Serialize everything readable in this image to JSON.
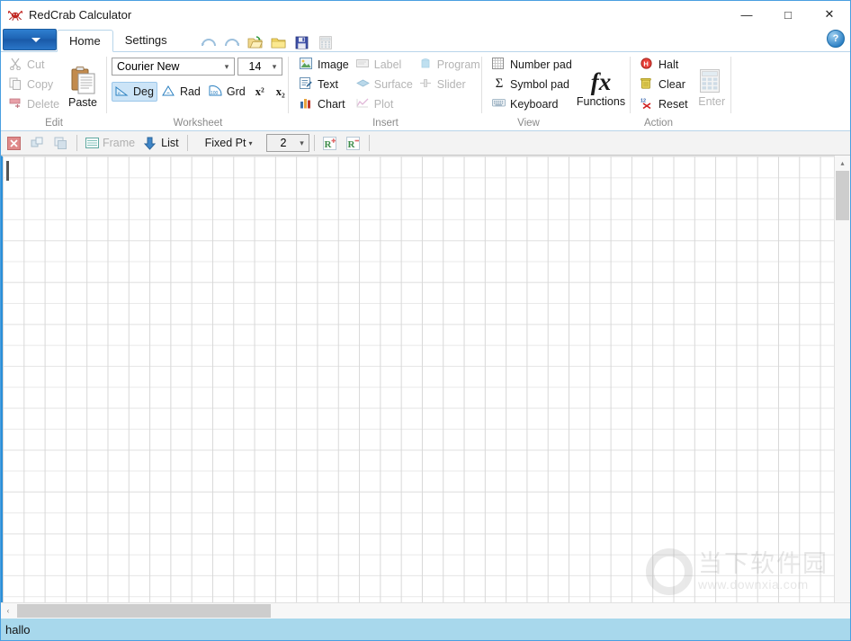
{
  "window": {
    "title": "RedCrab Calculator",
    "icon": "redcrab-icon",
    "minimize": "—",
    "maximize": "□",
    "close": "✕"
  },
  "tabs": {
    "app_button": "file-menu-chevron",
    "items": [
      {
        "label": "Home",
        "active": true
      },
      {
        "label": "Settings",
        "active": false
      }
    ],
    "help_label": "?",
    "quick_access": [
      {
        "name": "undo-icon",
        "label": "Undo",
        "disabled": true
      },
      {
        "name": "redo-icon",
        "label": "Redo",
        "disabled": true
      },
      {
        "name": "open-icon",
        "label": "Open",
        "disabled": false
      },
      {
        "name": "folder-icon",
        "label": "Folder",
        "disabled": false
      },
      {
        "name": "save-icon",
        "label": "Save",
        "disabled": false
      },
      {
        "name": "calculator-icon",
        "label": "Calculator",
        "disabled": true
      }
    ]
  },
  "ribbon": {
    "groups": [
      {
        "name": "edit",
        "label": "Edit",
        "items": [
          {
            "label": "Cut",
            "icon": "cut-icon",
            "disabled": true
          },
          {
            "label": "Copy",
            "icon": "copy-icon",
            "disabled": true
          },
          {
            "label": "Delete",
            "icon": "delete-icon",
            "disabled": true
          },
          {
            "label": "Paste",
            "icon": "paste-icon",
            "disabled": false
          }
        ]
      },
      {
        "name": "worksheet",
        "label": "Worksheet",
        "font_name": "Courier New",
        "font_size": "14",
        "items": [
          {
            "label": "Deg",
            "icon": "angle-deg-icon",
            "selected": true
          },
          {
            "label": "Rad",
            "icon": "angle-rad-icon",
            "selected": false
          },
          {
            "label": "Grd",
            "icon": "angle-grd-icon",
            "selected": false
          },
          {
            "label": "x²",
            "icon": "superscript-icon",
            "selected": false
          },
          {
            "label": "x₂",
            "icon": "subscript-icon",
            "selected": false
          }
        ]
      },
      {
        "name": "insert",
        "label": "Insert",
        "items": [
          {
            "label": "Image",
            "icon": "image-icon",
            "disabled": false
          },
          {
            "label": "Label",
            "icon": "label-icon",
            "disabled": true
          },
          {
            "label": "Program",
            "icon": "program-icon",
            "disabled": true
          },
          {
            "label": "Text",
            "icon": "text-icon",
            "disabled": false
          },
          {
            "label": "Surface",
            "icon": "surface-icon",
            "disabled": true
          },
          {
            "label": "Slider",
            "icon": "slider-icon",
            "disabled": true
          },
          {
            "label": "Chart",
            "icon": "chart-icon",
            "disabled": false
          },
          {
            "label": "Plot",
            "icon": "plot-icon",
            "disabled": true
          }
        ]
      },
      {
        "name": "view",
        "label": "View",
        "items": [
          {
            "label": "Number pad",
            "icon": "number-pad-icon",
            "disabled": false
          },
          {
            "label": "Symbol pad",
            "icon": "sigma-icon",
            "disabled": false
          },
          {
            "label": "Keyboard",
            "icon": "keyboard-icon",
            "disabled": false
          },
          {
            "label": "Functions",
            "icon": "fx-icon",
            "disabled": false
          }
        ]
      },
      {
        "name": "action",
        "label": "Action",
        "items": [
          {
            "label": "Halt",
            "icon": "halt-icon",
            "disabled": false
          },
          {
            "label": "Clear",
            "icon": "trash-icon",
            "disabled": false
          },
          {
            "label": "Reset",
            "icon": "reset-icon",
            "disabled": false
          },
          {
            "label": "Enter",
            "icon": "enter-icon",
            "disabled": true
          }
        ]
      }
    ]
  },
  "toolbar2": {
    "close_label": "✕",
    "frame_label": "Frame",
    "list_label": "List",
    "format_label": "Fixed Pt",
    "decimals_value": "2",
    "icons": [
      {
        "name": "delete-red-icon",
        "disabled": false
      },
      {
        "name": "group-icon",
        "disabled": true
      },
      {
        "name": "arrange-icon",
        "disabled": true
      },
      {
        "name": "frame-icon",
        "disabled": true
      },
      {
        "name": "list-down-icon",
        "disabled": false
      },
      {
        "name": "increase-decimals-icon",
        "disabled": false
      },
      {
        "name": "decrease-decimals-icon",
        "disabled": false
      }
    ]
  },
  "worksheet": {
    "content": "",
    "cursor_visible": true
  },
  "watermark": {
    "cn": "当下软件园",
    "url": "www.downxia.com"
  },
  "scrollbars": {
    "up_arrow": "▴",
    "down_arrow": "▾",
    "left_arrow": "‹",
    "right_arrow": "›"
  },
  "status": {
    "text": "hallo"
  }
}
